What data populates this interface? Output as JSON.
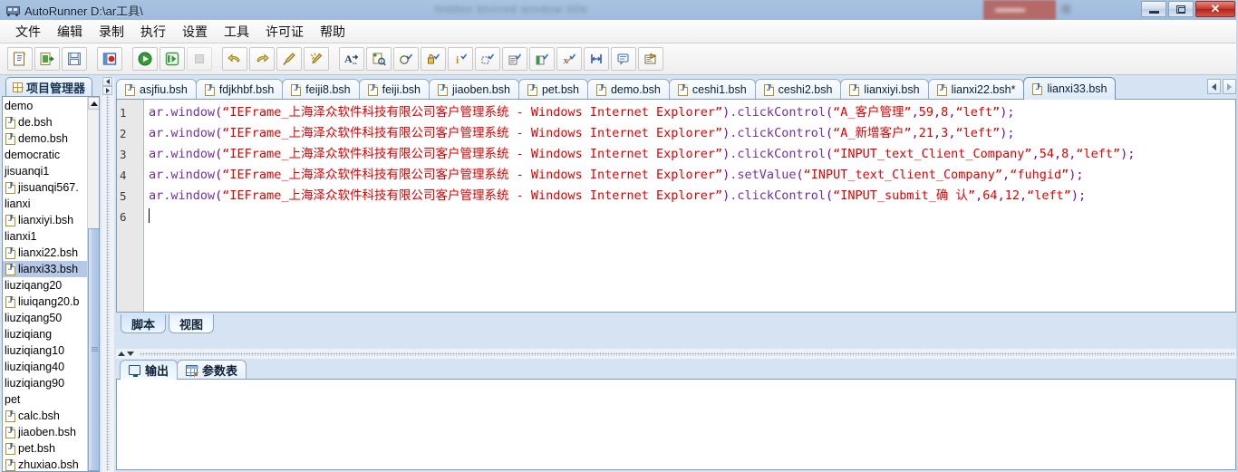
{
  "window": {
    "title": "AutoRunner  D:\\ar工具\\",
    "app_icon": "autorunner-icon",
    "minimize_label": "minimize",
    "maximize_label": "maximize",
    "close_label": "✕"
  },
  "background_window": {
    "blurred_title": "hidden blurred window title",
    "blurred_right": "blurred toolbar icons",
    "blurred_badge": "blurred"
  },
  "menubar": {
    "items": [
      {
        "label": "文件",
        "name": "menu-file"
      },
      {
        "label": "编辑",
        "name": "menu-edit"
      },
      {
        "label": "录制",
        "name": "menu-record"
      },
      {
        "label": "执行",
        "name": "menu-run"
      },
      {
        "label": "设置",
        "name": "menu-settings"
      },
      {
        "label": "工具",
        "name": "menu-tools"
      },
      {
        "label": "许可证",
        "name": "menu-license"
      },
      {
        "label": "帮助",
        "name": "menu-help"
      }
    ]
  },
  "toolbar": {
    "buttons": [
      {
        "icon": "new-script-icon",
        "title": "新建"
      },
      {
        "icon": "open-project-icon",
        "title": "打开"
      },
      {
        "icon": "save-icon",
        "title": "保存"
      },
      {
        "icon": "record-icon",
        "title": "录制"
      },
      {
        "icon": "run-icon",
        "title": "执行"
      },
      {
        "icon": "step-run-icon",
        "title": "单步执行"
      },
      {
        "icon": "stop-icon",
        "title": "停止"
      },
      {
        "icon": "undo-icon",
        "title": "撤销"
      },
      {
        "icon": "redo-icon",
        "title": "重做"
      },
      {
        "icon": "brush-icon",
        "title": "画笔"
      },
      {
        "icon": "wand-icon",
        "title": "魔棒"
      },
      {
        "icon": "text-insert-icon",
        "title": "插入文本"
      },
      {
        "icon": "capture-object-icon",
        "title": "捕获对象"
      },
      {
        "icon": "check-circle-icon",
        "title": "圆检查点"
      },
      {
        "icon": "check-lock-icon",
        "title": "安全检查点"
      },
      {
        "icon": "check-info-icon",
        "title": "信息检查点"
      },
      {
        "icon": "check-region-icon",
        "title": "区域检查点"
      },
      {
        "icon": "check-doc-icon",
        "title": "文档检查点"
      },
      {
        "icon": "check-export-icon",
        "title": "导出检查点"
      },
      {
        "icon": "check-formula-icon",
        "title": "公式检查点"
      },
      {
        "icon": "sync-point-icon",
        "title": "同步点"
      },
      {
        "icon": "message-icon",
        "title": "消息"
      },
      {
        "icon": "report-icon",
        "title": "报告"
      }
    ]
  },
  "sidebar": {
    "tab_label": "项目管理器",
    "tab_icon": "grid-icon",
    "scroll_up_icon": "scroll-up-arrow",
    "tree": [
      {
        "label": "demo",
        "type": "folder",
        "selected": false
      },
      {
        "label": "de.bsh",
        "type": "file",
        "selected": false
      },
      {
        "label": "demo.bsh",
        "type": "file",
        "selected": false
      },
      {
        "label": "democratic",
        "type": "folder",
        "selected": false
      },
      {
        "label": "jisuanqi1",
        "type": "folder",
        "selected": false
      },
      {
        "label": "jisuanqi567.",
        "type": "file",
        "selected": false
      },
      {
        "label": "lianxi",
        "type": "folder",
        "selected": false
      },
      {
        "label": "lianxiyi.bsh",
        "type": "file",
        "selected": false
      },
      {
        "label": "lianxi1",
        "type": "folder",
        "selected": false
      },
      {
        "label": "lianxi22.bsh",
        "type": "file",
        "selected": false
      },
      {
        "label": "lianxi33.bsh",
        "type": "file",
        "selected": true
      },
      {
        "label": "liuziqang20",
        "type": "folder",
        "selected": false
      },
      {
        "label": "liuiqang20.b",
        "type": "file",
        "selected": false
      },
      {
        "label": "liuziqang50",
        "type": "folder",
        "selected": false
      },
      {
        "label": "liuziqiang",
        "type": "folder",
        "selected": false
      },
      {
        "label": "liuziqiang10",
        "type": "folder",
        "selected": false
      },
      {
        "label": "liuziqiang40",
        "type": "folder",
        "selected": false
      },
      {
        "label": "liuziqiang90",
        "type": "folder",
        "selected": false
      },
      {
        "label": "pet",
        "type": "folder",
        "selected": false
      },
      {
        "label": "calc.bsh",
        "type": "file",
        "selected": false
      },
      {
        "label": "jiaoben.bsh",
        "type": "file",
        "selected": false
      },
      {
        "label": "pet.bsh",
        "type": "file",
        "selected": false
      },
      {
        "label": "zhuxiao.bsh",
        "type": "file",
        "selected": false
      }
    ]
  },
  "editor": {
    "tabs": [
      {
        "label": "asjfiu.bsh",
        "active": false
      },
      {
        "label": "fdjkhbf.bsh",
        "active": false
      },
      {
        "label": "feiji8.bsh",
        "active": false
      },
      {
        "label": "feiji.bsh",
        "active": false
      },
      {
        "label": "jiaoben.bsh",
        "active": false
      },
      {
        "label": "pet.bsh",
        "active": false
      },
      {
        "label": "demo.bsh",
        "active": false
      },
      {
        "label": "ceshi1.bsh",
        "active": false
      },
      {
        "label": "ceshi2.bsh",
        "active": false
      },
      {
        "label": "lianxiyi.bsh",
        "active": false
      },
      {
        "label": "lianxi22.bsh*",
        "active": false
      },
      {
        "label": "lianxi33.bsh",
        "active": true
      }
    ],
    "tab_prev_icon": "chevron-left-icon",
    "tab_next_icon": "chevron-right-icon",
    "line_numbers": [
      "1",
      "2",
      "3",
      "4",
      "5",
      "6"
    ],
    "code_lines": [
      {
        "number": "1",
        "tokens": [
          {
            "t": "ar.window",
            "k": "id"
          },
          {
            "t": "(",
            "k": "pun"
          },
          {
            "t": "“IEFrame_上海泽众软件科技有限公司客户管理系统 - Windows Internet Explorer”",
            "k": "str"
          },
          {
            "t": ")",
            "k": "pun"
          },
          {
            "t": ".clickControl",
            "k": "id"
          },
          {
            "t": "(",
            "k": "pun"
          },
          {
            "t": "“A_客户管理”",
            "k": "str"
          },
          {
            "t": ",",
            "k": "pun"
          },
          {
            "t": "59",
            "k": "num"
          },
          {
            "t": ",",
            "k": "pun"
          },
          {
            "t": "8",
            "k": "num"
          },
          {
            "t": ",",
            "k": "pun"
          },
          {
            "t": "“left”",
            "k": "str"
          },
          {
            "t": ");",
            "k": "pun"
          }
        ]
      },
      {
        "number": "2",
        "tokens": [
          {
            "t": "ar.window",
            "k": "id"
          },
          {
            "t": "(",
            "k": "pun"
          },
          {
            "t": "“IEFrame_上海泽众软件科技有限公司客户管理系统 - Windows Internet Explorer”",
            "k": "str"
          },
          {
            "t": ")",
            "k": "pun"
          },
          {
            "t": ".clickControl",
            "k": "id"
          },
          {
            "t": "(",
            "k": "pun"
          },
          {
            "t": "“A_新增客户”",
            "k": "str"
          },
          {
            "t": ",",
            "k": "pun"
          },
          {
            "t": "21",
            "k": "num"
          },
          {
            "t": ",",
            "k": "pun"
          },
          {
            "t": "3",
            "k": "num"
          },
          {
            "t": ",",
            "k": "pun"
          },
          {
            "t": "“left”",
            "k": "str"
          },
          {
            "t": ");",
            "k": "pun"
          }
        ]
      },
      {
        "number": "3",
        "tokens": [
          {
            "t": "ar.window",
            "k": "id"
          },
          {
            "t": "(",
            "k": "pun"
          },
          {
            "t": "“IEFrame_上海泽众软件科技有限公司客户管理系统 - Windows Internet Explorer”",
            "k": "str"
          },
          {
            "t": ")",
            "k": "pun"
          },
          {
            "t": ".clickControl",
            "k": "id"
          },
          {
            "t": "(",
            "k": "pun"
          },
          {
            "t": "“INPUT_text_Client_Company”",
            "k": "str"
          },
          {
            "t": ",",
            "k": "pun"
          },
          {
            "t": "54",
            "k": "num"
          },
          {
            "t": ",",
            "k": "pun"
          },
          {
            "t": "8",
            "k": "num"
          },
          {
            "t": ",",
            "k": "pun"
          },
          {
            "t": "“left”",
            "k": "str"
          },
          {
            "t": ");",
            "k": "pun"
          }
        ]
      },
      {
        "number": "4",
        "tokens": [
          {
            "t": "ar.window",
            "k": "id"
          },
          {
            "t": "(",
            "k": "pun"
          },
          {
            "t": "“IEFrame_上海泽众软件科技有限公司客户管理系统 - Windows Internet Explorer”",
            "k": "str"
          },
          {
            "t": ")",
            "k": "pun"
          },
          {
            "t": ".setValue",
            "k": "id"
          },
          {
            "t": "(",
            "k": "pun"
          },
          {
            "t": "“INPUT_text_Client_Company”",
            "k": "str"
          },
          {
            "t": ",",
            "k": "pun"
          },
          {
            "t": "“fuhgid”",
            "k": "str"
          },
          {
            "t": ");",
            "k": "pun"
          }
        ]
      },
      {
        "number": "5",
        "tokens": [
          {
            "t": "ar.window",
            "k": "id"
          },
          {
            "t": "(",
            "k": "pun"
          },
          {
            "t": "“IEFrame_上海泽众软件科技有限公司客户管理系统 - Windows Internet Explorer”",
            "k": "str"
          },
          {
            "t": ")",
            "k": "pun"
          },
          {
            "t": ".clickControl",
            "k": "id"
          },
          {
            "t": "(",
            "k": "pun"
          },
          {
            "t": "“INPUT_submit_确  认”",
            "k": "str"
          },
          {
            "t": ",",
            "k": "pun"
          },
          {
            "t": "64",
            "k": "num"
          },
          {
            "t": ",",
            "k": "pun"
          },
          {
            "t": "12",
            "k": "num"
          },
          {
            "t": ",",
            "k": "pun"
          },
          {
            "t": "“left”",
            "k": "str"
          },
          {
            "t": ");",
            "k": "pun"
          }
        ]
      },
      {
        "number": "6",
        "tokens": []
      }
    ],
    "sub_tabs": [
      {
        "label": "脚本",
        "active": true
      },
      {
        "label": "视图",
        "active": false
      }
    ]
  },
  "output": {
    "tabs": [
      {
        "label": "输出",
        "icon": "monitor-icon",
        "active": true
      },
      {
        "label": "参数表",
        "icon": "table-icon",
        "active": false
      }
    ],
    "content": ""
  },
  "colors": {
    "identifier": "#7030a0",
    "string": "#e00000",
    "punctuation": "#6a0dad",
    "selection": "#b6c8e8",
    "titlebar": "#a9c2e0",
    "close_button": "#c4352b"
  }
}
